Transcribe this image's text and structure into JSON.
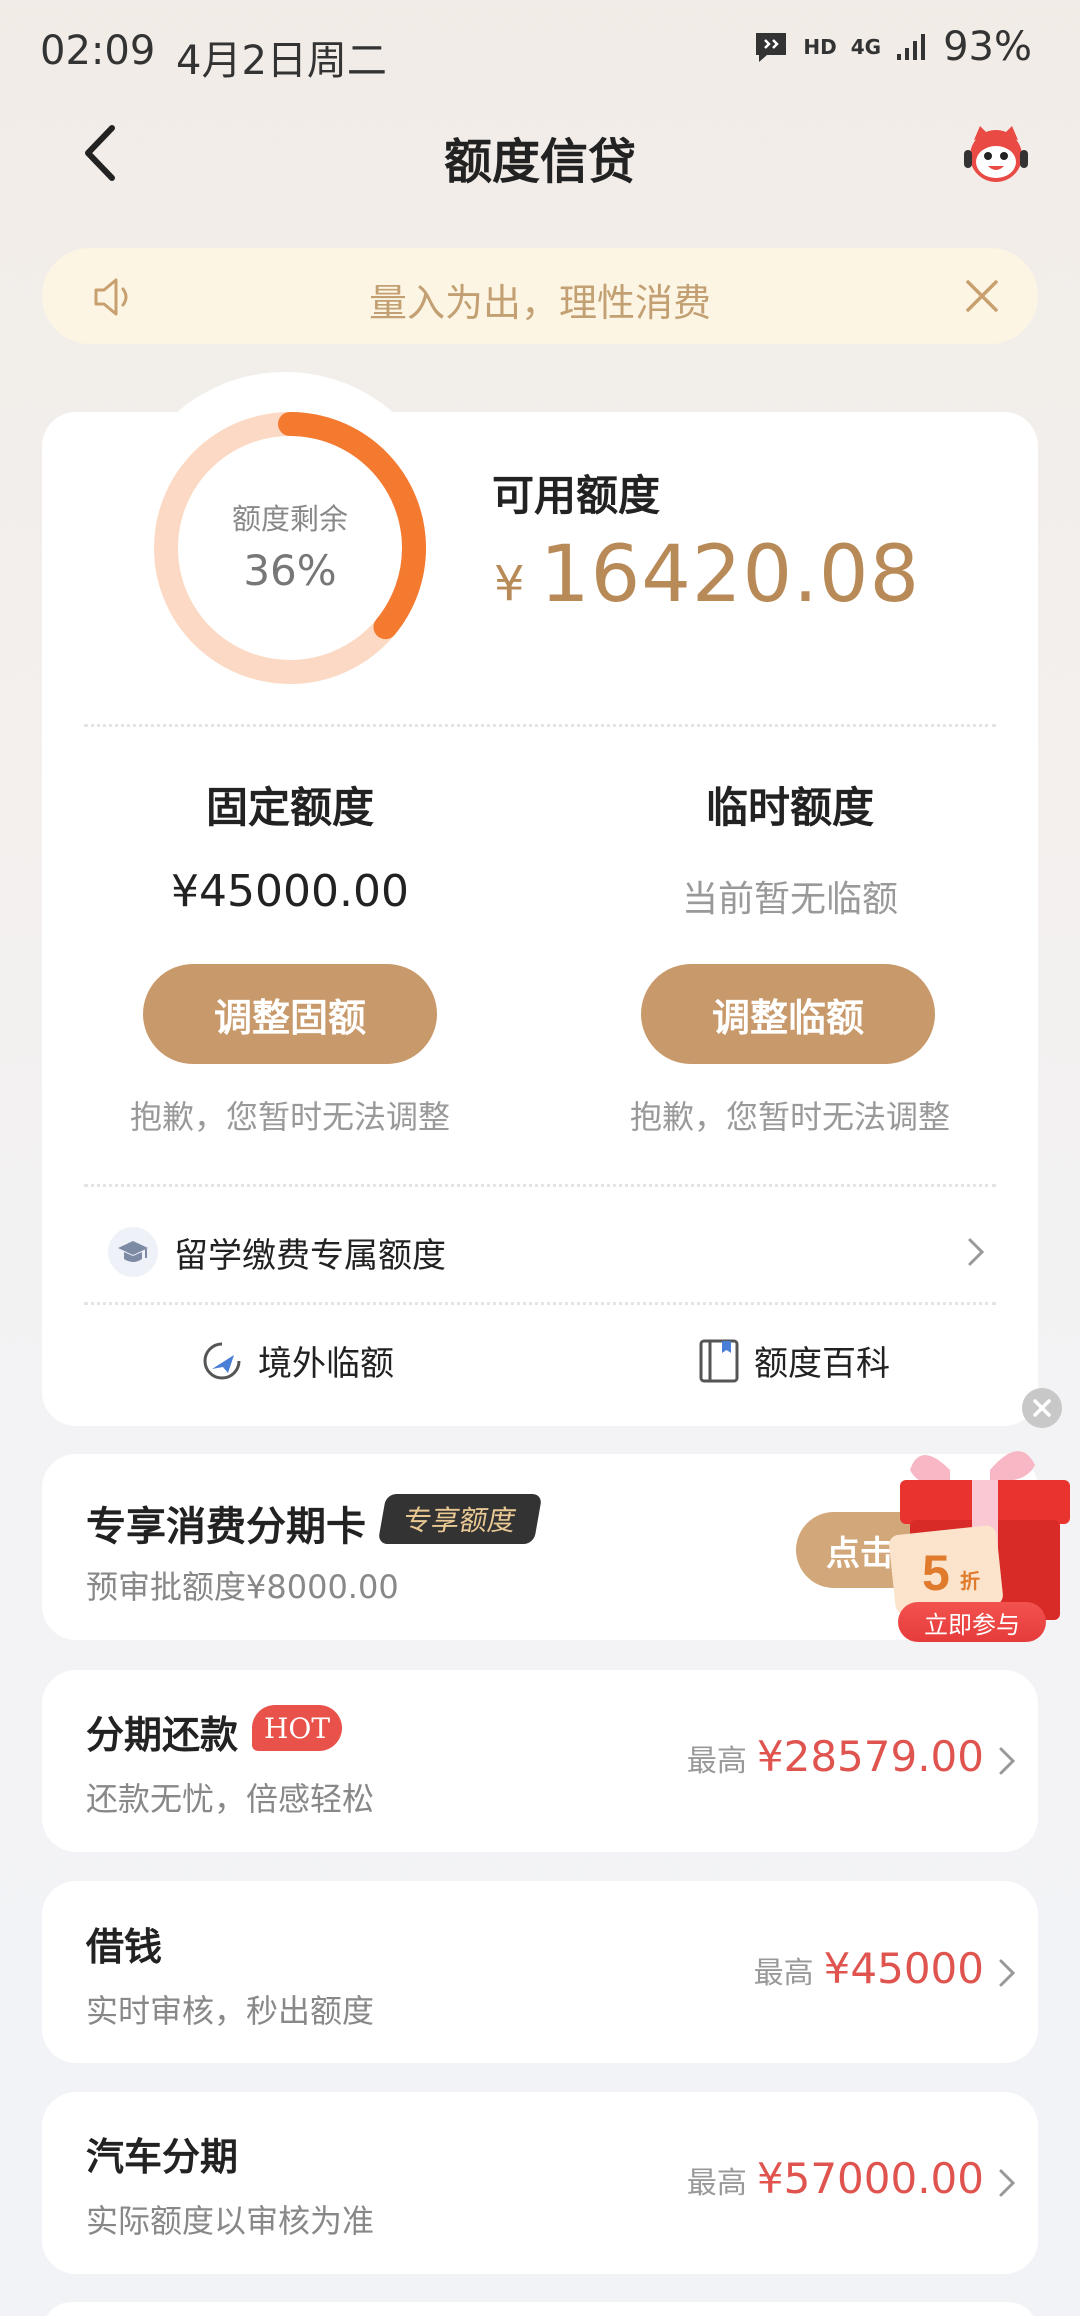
{
  "status_bar": {
    "time": "02:09",
    "date": "4月2日周二",
    "hd": "HD",
    "network": "4G",
    "battery": "93%"
  },
  "header": {
    "title": "额度信贷",
    "back_icon": "back-arrow-icon",
    "service_icon": "customer-service-mascot-icon"
  },
  "notice": {
    "text": "量入为出，理性消费",
    "icon": "speaker-icon",
    "close_icon": "close-icon"
  },
  "credit": {
    "ring_label": "额度剩余",
    "ring_percent_text": "36%",
    "remaining_fraction": 0.36,
    "available_label": "可用额度",
    "currency": "¥",
    "available_amount": "16420.08",
    "fixed": {
      "title": "固定额度",
      "value": "¥45000.00",
      "button": "调整固额",
      "note": "抱歉，您暂时无法调整"
    },
    "temporary": {
      "title": "临时额度",
      "value": "当前暂无临额",
      "button": "调整临额",
      "note": "抱歉，您暂时无法调整"
    },
    "study_abroad": "留学缴费专属额度",
    "overseas": "境外临额",
    "encyclopedia": "额度百科"
  },
  "promo": {
    "title": "专享消费分期卡",
    "tag": "专享额度",
    "subtitle": "预审批额度¥8000.00",
    "button": "点击",
    "gift_discount": "5",
    "gift_discount_unit": "折",
    "gift_badge": "立即参与"
  },
  "products": [
    {
      "title": "分期还款",
      "tag": "HOT",
      "subtitle": "还款无忧，倍感轻松",
      "max_label": "最高",
      "amount": "¥28579.00"
    },
    {
      "title": "借钱",
      "subtitle": "实时审核，秒出额度",
      "max_label": "最高",
      "amount": "¥45000"
    },
    {
      "title": "汽车分期",
      "subtitle": "实际额度以审核为准",
      "max_label": "最高",
      "amount": "¥57000.00"
    }
  ],
  "colors": {
    "accent_gold": "#c8996a",
    "amount_gold": "#b88a57",
    "ring_orange": "#f47a30",
    "ring_track": "#fbd9c4",
    "price_red": "#e0544f"
  }
}
